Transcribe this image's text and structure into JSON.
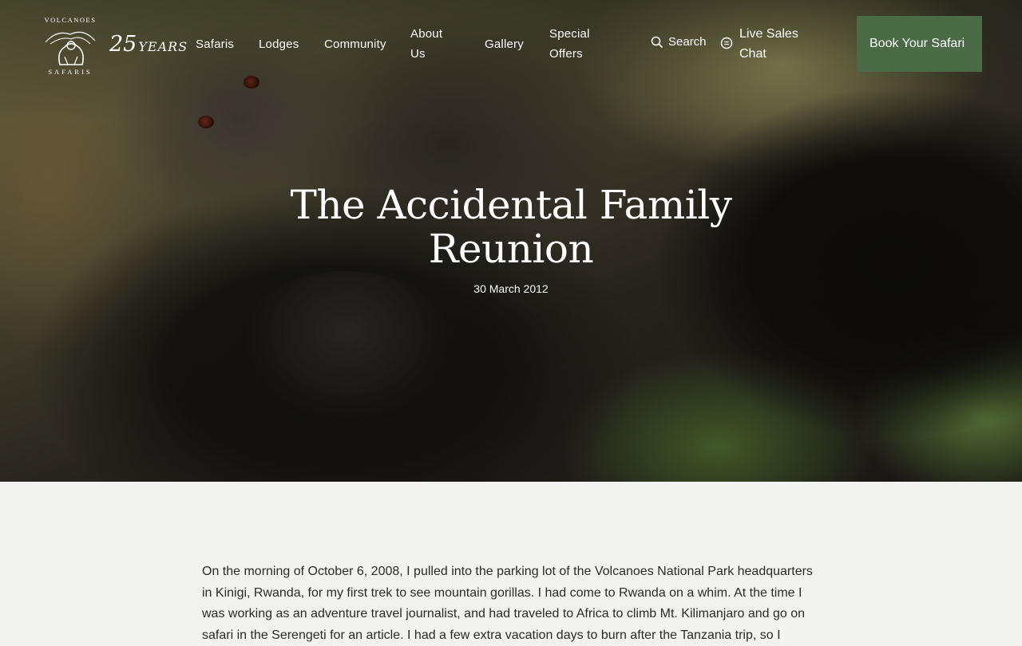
{
  "brand": {
    "logo_top": "VOLCANOES",
    "logo_bottom": "SAFARIS",
    "anniversary_number": "25",
    "anniversary_label": "YEARS"
  },
  "nav": {
    "items": [
      "Safaris",
      "Lodges",
      "Community",
      "About Us",
      "Gallery",
      "Special Offers"
    ],
    "search_label": "Search",
    "chat_label": "Live Sales Chat",
    "book_label": "Book Your Safari"
  },
  "hero": {
    "title": "The Accidental Family Reunion",
    "date": "30 March 2012"
  },
  "article": {
    "intro": "On the morning of October 6, 2008, I pulled into the parking lot of the Volcanoes National Park headquarters in Kinigi, Rwanda, for my first trek to see mountain gorillas. I had come to Rwanda on a whim. At the time I was working as an adventure travel journalist, and had traveled to Africa to climb Mt. Kilimanjaro and go on safari in the Serengeti for an article. I had a few extra vacation days to burn after the Tanzania trip, so I"
  },
  "colors": {
    "accent": "#4b6a46",
    "page_bg": "#f2f2f0"
  },
  "icons": [
    "gorilla-logo-icon",
    "search-icon",
    "chat-icon"
  ]
}
